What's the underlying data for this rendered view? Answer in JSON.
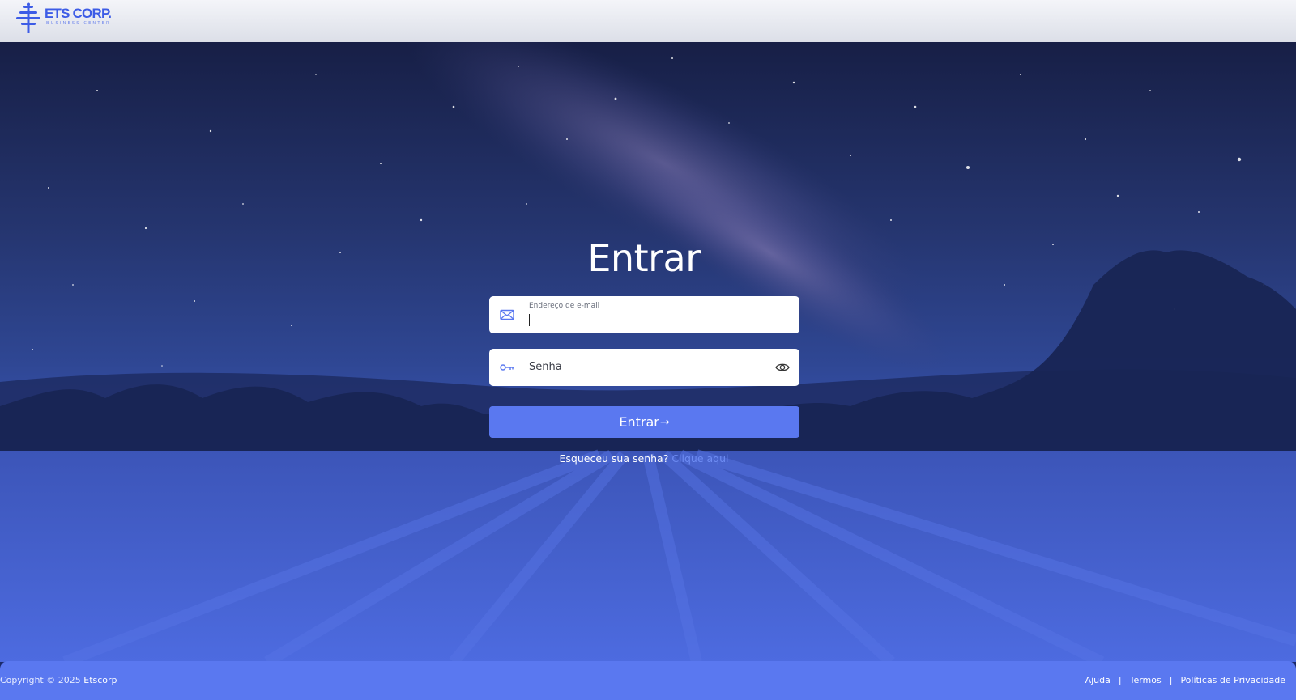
{
  "header": {
    "logo_title": "ETS CORP.",
    "logo_subtitle": "BUSINESS CENTER",
    "logo_icon": "tree-icon"
  },
  "login": {
    "title": "Entrar",
    "email_label": "Endereço de e-mail",
    "email_value": "",
    "email_icon": "envelope-icon",
    "password_placeholder": "Senha",
    "password_icon": "key-icon",
    "password_toggle_icon": "eye-icon",
    "submit_label": "Entrar",
    "submit_arrow": "→",
    "forgot_text": "Esqueceu sua senha?",
    "forgot_link": "Clique aqui"
  },
  "footer": {
    "copyright_prefix": "Copyright © 2025",
    "company": "Etscorp",
    "links": [
      "Ajuda",
      "Termos",
      "Políticas de Privacidade"
    ],
    "separator": "|"
  },
  "colors": {
    "accent": "#5a78f0",
    "logo_blue": "#3d5ce6",
    "link_light": "#6e8cf3",
    "header_bg": "#e6e8ef"
  }
}
